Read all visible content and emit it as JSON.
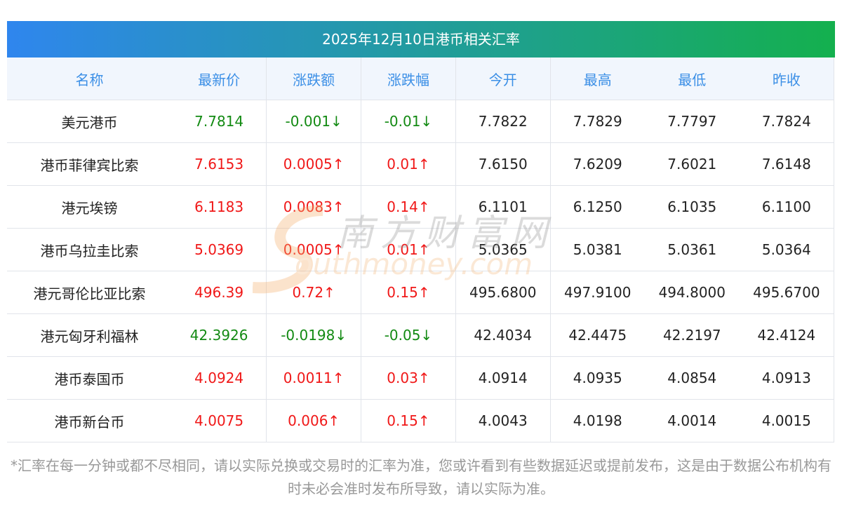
{
  "title": "2025年12月10日港币相关汇率",
  "headers": [
    "名称",
    "最新价",
    "涨跌额",
    "涨跌幅",
    "今开",
    "最高",
    "最低",
    "昨收"
  ],
  "rows": [
    {
      "name": "美元港币",
      "price": "7.7814",
      "chg": "-0.001↓",
      "pct": "-0.01↓",
      "open": "7.7822",
      "high": "7.7829",
      "low": "7.7797",
      "prev": "7.7824",
      "dir": "down"
    },
    {
      "name": "港币菲律宾比索",
      "price": "7.6153",
      "chg": "0.0005↑",
      "pct": "0.01↑",
      "open": "7.6150",
      "high": "7.6209",
      "low": "7.6021",
      "prev": "7.6148",
      "dir": "up"
    },
    {
      "name": "港元埃镑",
      "price": "6.1183",
      "chg": "0.0083↑",
      "pct": "0.14↑",
      "open": "6.1101",
      "high": "6.1250",
      "low": "6.1035",
      "prev": "6.1100",
      "dir": "up"
    },
    {
      "name": "港币乌拉圭比索",
      "price": "5.0369",
      "chg": "0.0005↑",
      "pct": "0.01↑",
      "open": "5.0365",
      "high": "5.0381",
      "low": "5.0361",
      "prev": "5.0364",
      "dir": "up"
    },
    {
      "name": "港元哥伦比亚比索",
      "price": "496.39",
      "chg": "0.72↑",
      "pct": "0.15↑",
      "open": "495.6800",
      "high": "497.9100",
      "low": "494.8000",
      "prev": "495.6700",
      "dir": "up"
    },
    {
      "name": "港元匈牙利福林",
      "price": "42.3926",
      "chg": "-0.0198↓",
      "pct": "-0.05↓",
      "open": "42.4034",
      "high": "42.4475",
      "low": "42.2197",
      "prev": "42.4124",
      "dir": "down"
    },
    {
      "name": "港币泰国币",
      "price": "4.0924",
      "chg": "0.0011↑",
      "pct": "0.03↑",
      "open": "4.0914",
      "high": "4.0935",
      "low": "4.0854",
      "prev": "4.0913",
      "dir": "up"
    },
    {
      "name": "港币新台币",
      "price": "4.0075",
      "chg": "0.006↑",
      "pct": "0.15↑",
      "open": "4.0043",
      "high": "4.0198",
      "low": "4.0014",
      "prev": "4.0015",
      "dir": "up"
    }
  ],
  "watermark": {
    "cn": "南方财富网",
    "en": "southmoney.com"
  },
  "note": "*汇率在每一分钟或都不尽相同，请以实际兑换或交易时的汇率为准，您或许看到有些数据延迟或提前发布，这是由于数据公布机构有时未必会准时发布所导致，请以实际为准。"
}
